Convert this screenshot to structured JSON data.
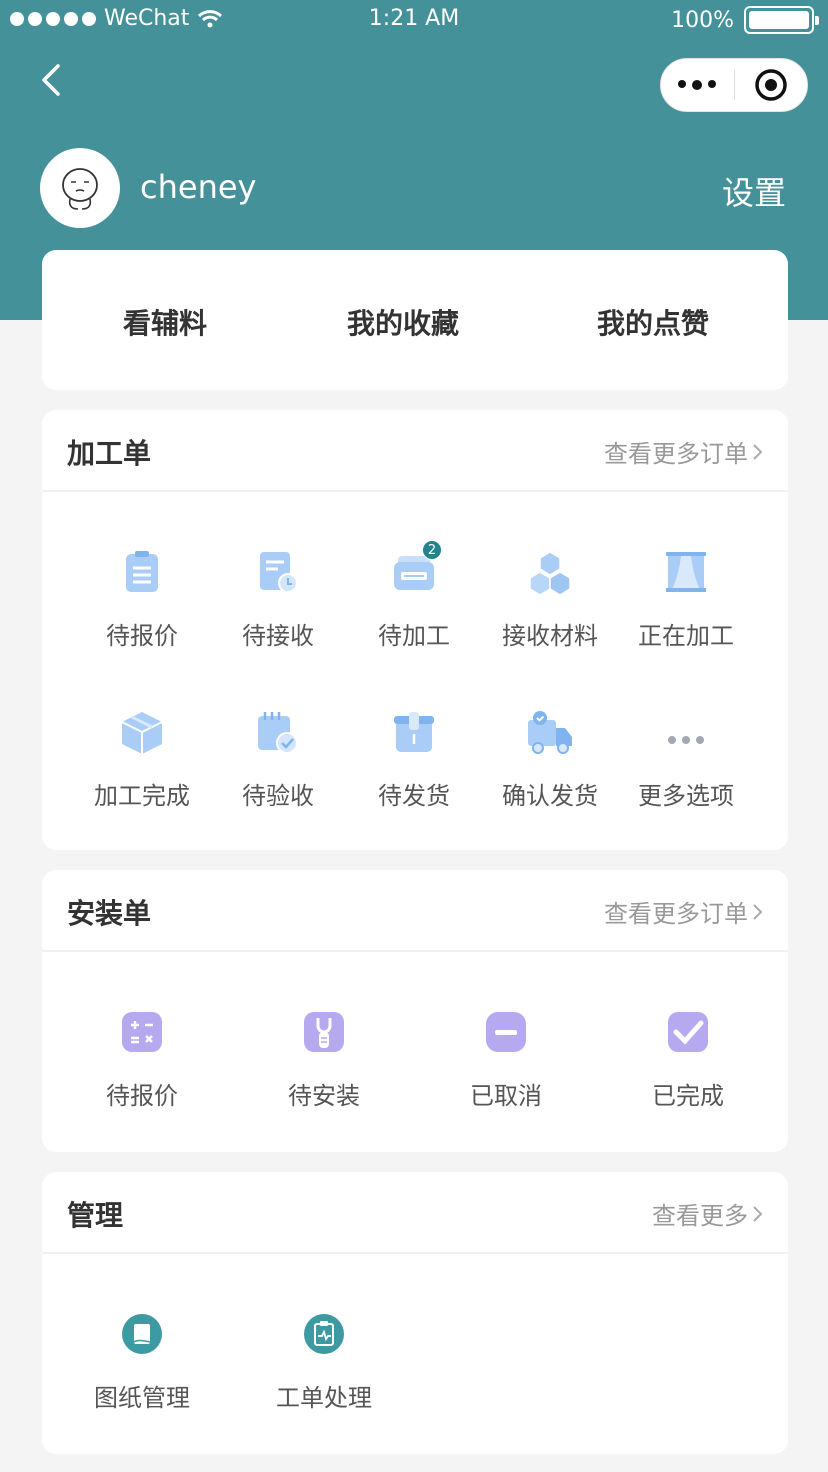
{
  "status_bar": {
    "carrier": "WeChat",
    "time": "1:21 AM",
    "battery": "100%"
  },
  "profile": {
    "username": "cheney",
    "settings_label": "设置"
  },
  "quick_links": [
    "看辅料",
    "我的收藏",
    "我的点赞"
  ],
  "processing": {
    "title": "加工单",
    "more_label": "查看更多订单",
    "items": [
      {
        "label": "待报价",
        "icon": "clipboard-list-icon"
      },
      {
        "label": "待接收",
        "icon": "document-clock-icon"
      },
      {
        "label": "待加工",
        "icon": "card-stack-icon",
        "badge": "2"
      },
      {
        "label": "接收材料",
        "icon": "boxes-icon"
      },
      {
        "label": "正在加工",
        "icon": "curtain-icon"
      },
      {
        "label": "加工完成",
        "icon": "package-icon"
      },
      {
        "label": "待验收",
        "icon": "calendar-check-icon"
      },
      {
        "label": "待发货",
        "icon": "bag-icon"
      },
      {
        "label": "确认发货",
        "icon": "truck-icon"
      },
      {
        "label": "更多选项",
        "icon": "more-dots-icon"
      }
    ]
  },
  "install": {
    "title": "安装单",
    "more_label": "查看更多订单",
    "items": [
      {
        "label": "待报价",
        "icon": "calculator-icon"
      },
      {
        "label": "待安装",
        "icon": "wrench-icon"
      },
      {
        "label": "已取消",
        "icon": "minus-icon"
      },
      {
        "label": "已完成",
        "icon": "check-icon"
      }
    ]
  },
  "management": {
    "title": "管理",
    "more_label": "查看更多",
    "items": [
      {
        "label": "图纸管理",
        "icon": "drawing-icon"
      },
      {
        "label": "工单处理",
        "icon": "clipboard-pulse-icon"
      }
    ]
  },
  "colors": {
    "header": "#45919a",
    "icon_blue": "#a9cdf6",
    "icon_purple": "#b7a9f0",
    "icon_teal": "#3d9aa2"
  }
}
